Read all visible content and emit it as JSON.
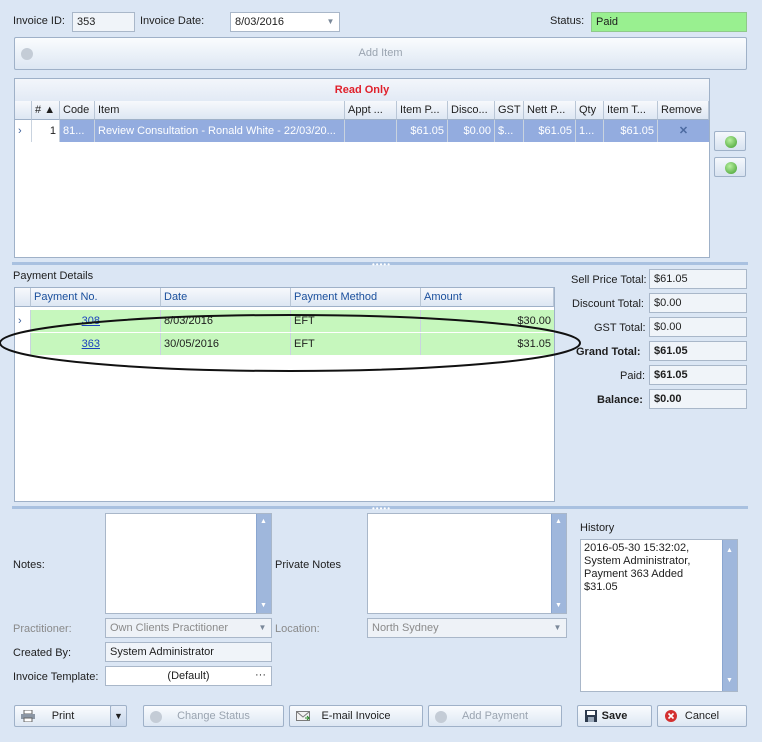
{
  "header": {
    "invoice_id_label": "Invoice ID:",
    "invoice_id": "353",
    "invoice_date_label": "Invoice Date:",
    "invoice_date": "8/03/2016",
    "status_label": "Status:",
    "status": "Paid"
  },
  "add_item_label": "Add Item",
  "items_grid": {
    "banner": "Read Only",
    "columns": [
      "#",
      "Code",
      "Item",
      "Appt ...",
      "Item P...",
      "Disco...",
      "GST",
      "Nett P...",
      "Qty",
      "Item T...",
      "Remove"
    ],
    "rows": [
      {
        "num": "1",
        "code": "81...",
        "item": "Review Consultation - Ronald White - 22/03/20...",
        "appt": "",
        "item_price": "$61.05",
        "discount": "$0.00",
        "gst": "$...",
        "nett_price": "$61.05",
        "qty": "1...",
        "item_total": "$61.05",
        "remove": "✕"
      }
    ]
  },
  "payment": {
    "section_label": "Payment Details",
    "columns": [
      "Payment No.",
      "Date",
      "Payment Method",
      "Amount"
    ],
    "rows": [
      {
        "no": "308",
        "date": "8/03/2016",
        "method": "EFT",
        "amount": "$30.00"
      },
      {
        "no": "363",
        "date": "30/05/2016",
        "method": "EFT",
        "amount": "$31.05"
      }
    ]
  },
  "totals": {
    "sell_price_label": "Sell Price Total:",
    "sell_price": "$61.05",
    "discount_label": "Discount Total:",
    "discount": "$0.00",
    "gst_label": "GST Total:",
    "gst": "$0.00",
    "grand_label": "Grand Total:",
    "grand": "$61.05",
    "paid_label": "Paid:",
    "paid": "$61.05",
    "balance_label": "Balance:",
    "balance": "$0.00"
  },
  "details": {
    "notes_label": "Notes:",
    "private_notes_label": "Private Notes",
    "history_label": "History",
    "history_text": "2016-05-30 15:32:02, System Administrator, Payment 363 Added $31.05",
    "practitioner_label": "Practitioner:",
    "practitioner": "Own Clients Practitioner",
    "location_label": "Location:",
    "location": "North Sydney",
    "created_by_label": "Created By:",
    "created_by": "System Administrator",
    "template_label": "Invoice Template:",
    "template": "(Default)",
    "template_ellipsis": "···"
  },
  "footer": {
    "print": "Print",
    "change_status": "Change Status",
    "email_invoice": "E-mail Invoice",
    "add_payment": "Add Payment",
    "save": "Save",
    "cancel": "Cancel"
  },
  "colors": {
    "status_bg": "#99f090",
    "selected_row": "#93acdf",
    "payment_row": "#c6f7bd",
    "read_only": "#e0202b"
  },
  "icons": [
    "add-icon",
    "move-up-icon",
    "move-down-icon",
    "print-icon",
    "change-status-icon",
    "email-icon",
    "add-payment-icon",
    "save-icon",
    "cancel-icon",
    "remove-icon"
  ]
}
